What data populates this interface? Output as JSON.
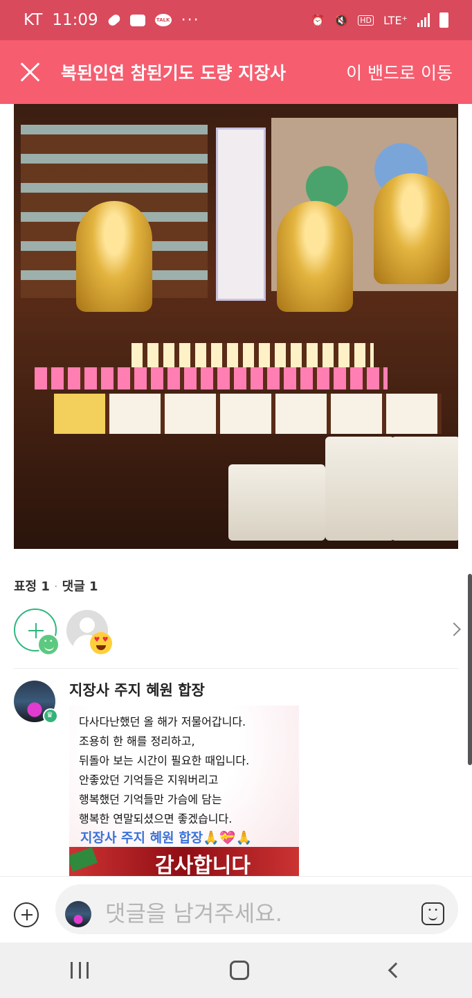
{
  "status_bar": {
    "carrier": "KT",
    "time": "11:09",
    "network": "LTE⁺",
    "talk_label": "TALK",
    "hd_label": "HD"
  },
  "header": {
    "title": "복된인연 참된기도 도량 지장사",
    "action_label": "이 밴드로 이동"
  },
  "post": {
    "reactions_label": "표정 1",
    "comments_label": "댓글 1"
  },
  "comment": {
    "author": "지장사 주지 혜원 합장",
    "card_lines": [
      "다사다난했던 올 해가 저물어갑니다.",
      "조용히 한 해를 정리하고,",
      "뒤돌아 보는 시간이 필요한 때입니다.",
      "안좋았던 기억들은 지워버리고",
      "행복했던 기억들만 가슴에 담는",
      "행복한 연말되셨으면 좋겠습니다."
    ],
    "card_signature": "지장사 주지 혜원 합장🙏💝🙏",
    "card_thanks": "감사합니다"
  },
  "input": {
    "placeholder": "댓글을 남겨주세요."
  },
  "colors": {
    "status_bar": "#d94a5c",
    "header": "#f65d6f",
    "reaction_green": "#2eb67d"
  }
}
